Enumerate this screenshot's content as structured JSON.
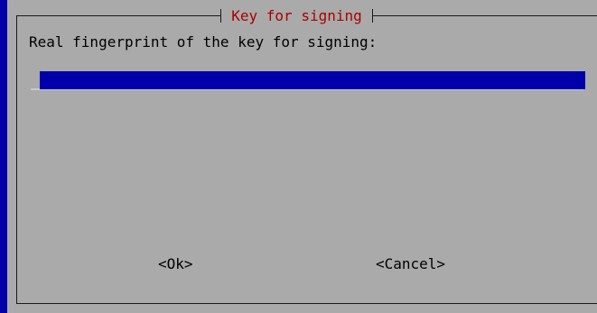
{
  "dialog": {
    "title": "Key for signing",
    "prompt": "Real fingerprint of the key for signing:",
    "input": {
      "value": ""
    },
    "buttons": {
      "ok_label": "<Ok>",
      "cancel_label": "<Cancel>"
    }
  },
  "colors": {
    "background": "#0000aa",
    "dialog": "#aaaaaa",
    "title": "#aa0000",
    "input_field": "#0000aa"
  }
}
